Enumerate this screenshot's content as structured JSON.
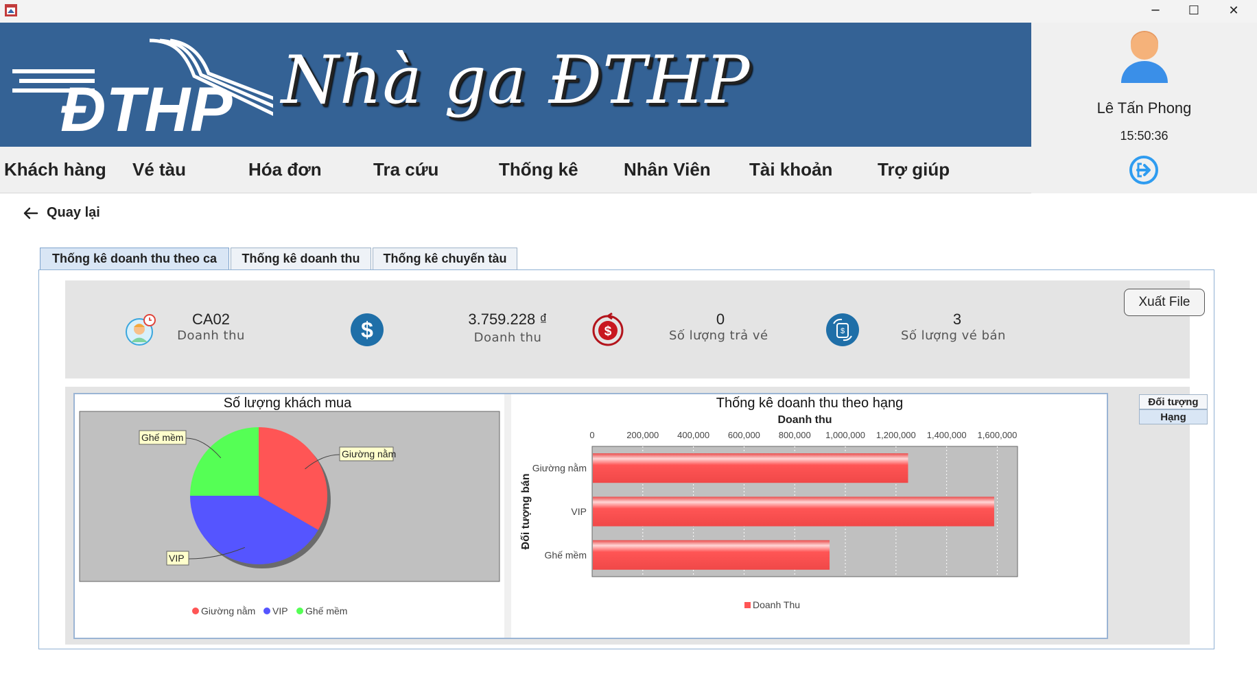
{
  "window": {
    "minimize": "─",
    "maximize": "☐",
    "close": "✕"
  },
  "header": {
    "logo_text": "ĐTHP",
    "title": "Nhà ga ĐTHP"
  },
  "user": {
    "name": "Lê Tấn Phong",
    "time": "15:50:36",
    "logout_icon": "logout-icon",
    "avatar_icon": "user-avatar-icon"
  },
  "menu": [
    {
      "label": "Khách hàng"
    },
    {
      "label": "Vé tàu"
    },
    {
      "label": "Hóa đơn"
    },
    {
      "label": "Tra cứu"
    },
    {
      "label": "Thống kê"
    },
    {
      "label": "Nhân Viên"
    },
    {
      "label": "Tài khoản"
    },
    {
      "label": "Trợ giúp"
    }
  ],
  "back": {
    "label": "Quay lại",
    "icon": "arrow-left-icon"
  },
  "tabs": [
    {
      "label": "Thống kê doanh thu theo ca",
      "active": true
    },
    {
      "label": "Thống kê doanh thu",
      "active": false
    },
    {
      "label": "Thống kê chuyến tàu",
      "active": false
    }
  ],
  "stats": [
    {
      "value": "CA02",
      "label": "Doanh thu",
      "icon": "employee-shift-icon"
    },
    {
      "value": "3.759.228 ₫",
      "label": "Doanh thu",
      "icon": "dollar-icon"
    },
    {
      "value": "0",
      "label": "Số lượng trả vé",
      "icon": "refund-icon"
    },
    {
      "value": "3",
      "label": "Số lượng vé bán",
      "icon": "ticket-exchange-icon"
    }
  ],
  "export_button": "Xuất File",
  "side_tabs": [
    {
      "label": "Đối tượng"
    },
    {
      "label": "Hạng"
    }
  ],
  "chart_data": [
    {
      "type": "pie",
      "title": "Số lượng khách mua",
      "categories": [
        "Giường nằm",
        "VIP",
        "Ghế mềm"
      ],
      "values": [
        33.3,
        41.7,
        25.0
      ],
      "colors": [
        "#ff5555",
        "#5555ff",
        "#55ff55"
      ],
      "legend": "bottom"
    },
    {
      "type": "bar",
      "orientation": "horizontal",
      "title": "Thống kê doanh thu theo hạng",
      "xlabel": "Doanh thu",
      "ylabel": "Đối tượng bán",
      "categories": [
        "Giường nằm",
        "VIP",
        "Ghế mềm"
      ],
      "series": [
        {
          "name": "Doanh Thu",
          "values": [
            1245000,
            1585000,
            935000
          ]
        }
      ],
      "xlim": [
        0,
        1680000
      ],
      "ticks": [
        "0",
        "200,000",
        "400,000",
        "600,000",
        "800,000",
        "1,000,000",
        "1,200,000",
        "1,400,000",
        "1,600,000"
      ],
      "tick_values": [
        0,
        200000,
        400000,
        600000,
        800000,
        1000000,
        1200000,
        1400000,
        1600000
      ],
      "color": "#ff5555",
      "grid": true,
      "legend": "bottom"
    }
  ]
}
